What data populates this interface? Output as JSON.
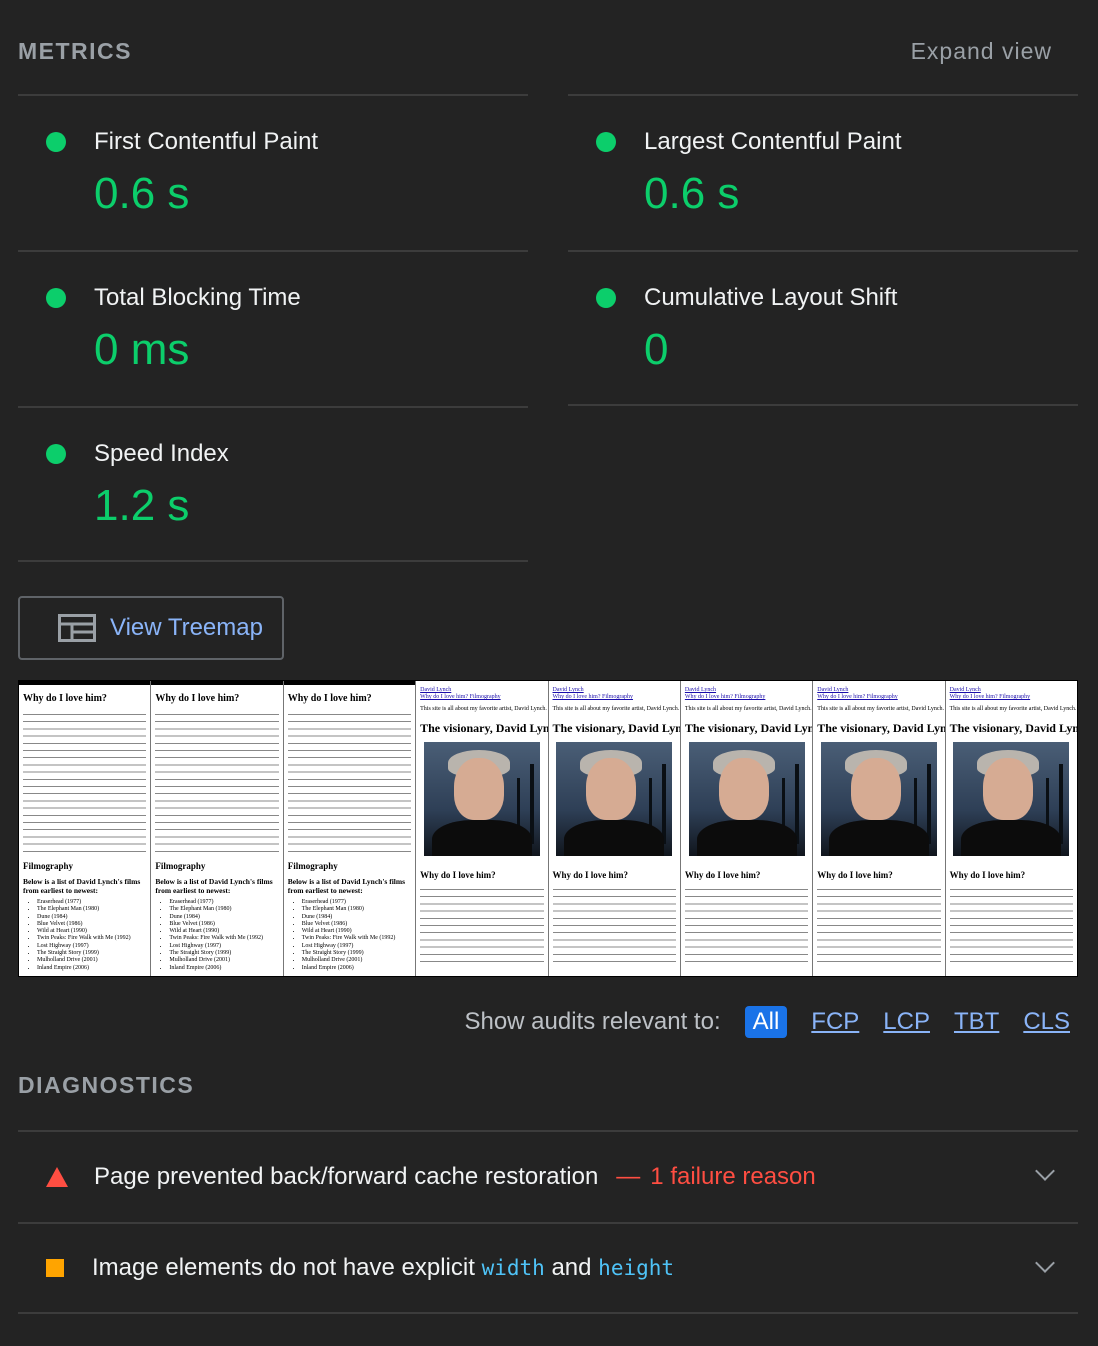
{
  "header": {
    "title": "METRICS",
    "expand_label": "Expand view"
  },
  "metrics": [
    {
      "name": "First Contentful Paint",
      "value": "0.6 s",
      "status_color": "#0cce6b"
    },
    {
      "name": "Largest Contentful Paint",
      "value": "0.6 s",
      "status_color": "#0cce6b"
    },
    {
      "name": "Total Blocking Time",
      "value": "0 ms",
      "status_color": "#0cce6b"
    },
    {
      "name": "Cumulative Layout Shift",
      "value": "0",
      "status_color": "#0cce6b"
    },
    {
      "name": "Speed Index",
      "value": "1.2 s",
      "status_color": "#0cce6b"
    }
  ],
  "treemap": {
    "label": "View Treemap",
    "icon": "treemap-icon"
  },
  "filmstrip": {
    "frames_a": {
      "heading": "Why do I love him?",
      "filmography": "Filmography",
      "list_intro": "Below is a list of David Lynch's films from earliest to newest:",
      "films": [
        "Eraserhead (1977)",
        "The Elephant Man (1980)",
        "Dune (1984)",
        "Blue Velvet (1986)",
        "Wild at Heart (1990)",
        "Twin Peaks: Fire Walk with Me (1992)",
        "Lost Highway (1997)",
        "The Straight Story (1999)",
        "Mulholland Drive (2001)",
        "Inland Empire (2006)"
      ]
    },
    "frames_b": {
      "nav_1": "David Lynch",
      "nav_2": "Why do I love him? Filmography",
      "intro": "This site is all about my favorite artist, David Lynch. May he rest in peace.",
      "title": "The visionary, David Lynch",
      "heading": "Why do I love him?"
    }
  },
  "audit_filter": {
    "label": "Show audits relevant to:",
    "options": [
      "All",
      "FCP",
      "LCP",
      "TBT",
      "CLS"
    ],
    "selected": "All"
  },
  "diagnostics": {
    "title": "DIAGNOSTICS",
    "items": [
      {
        "text": "Page prevented back/forward cache restoration",
        "separator": "—",
        "detail": "1 failure reason",
        "severity_color": "#ff4e42"
      },
      {
        "text_1": "Image elements do not have explicit",
        "code_1": "width",
        "text_2": "and",
        "code_2": "height",
        "severity_color": "#ffa400"
      }
    ]
  }
}
